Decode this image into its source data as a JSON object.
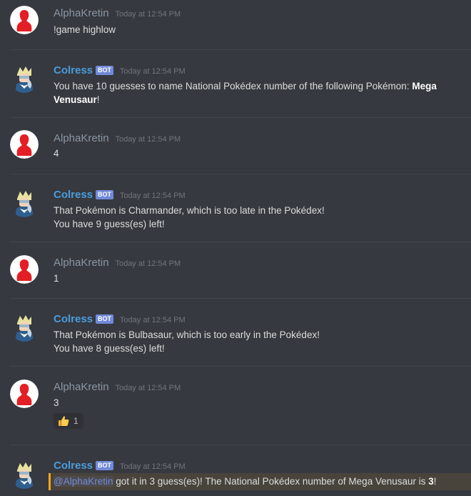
{
  "channel": {
    "messages": [
      {
        "author": "AlphaKretin",
        "is_bot": false,
        "timestamp": "Today at 12:54 PM",
        "text": "!game highlow"
      },
      {
        "author": "Colress",
        "is_bot": true,
        "bot_tag": "BOT",
        "timestamp": "Today at 12:54 PM",
        "text_prefix": "You have 10 guesses to name National Pokédex number of the following Pokémon: ",
        "text_bold": "Mega Venusaur",
        "text_suffix": "!"
      },
      {
        "author": "AlphaKretin",
        "is_bot": false,
        "timestamp": "Today at 12:54 PM",
        "text": "4"
      },
      {
        "author": "Colress",
        "is_bot": true,
        "bot_tag": "BOT",
        "timestamp": "Today at 12:54 PM",
        "line1": "That Pokémon is Charmander, which is too late in the Pokédex!",
        "line2": "You have 9 guess(es) left!"
      },
      {
        "author": "AlphaKretin",
        "is_bot": false,
        "timestamp": "Today at 12:54 PM",
        "text": "1"
      },
      {
        "author": "Colress",
        "is_bot": true,
        "bot_tag": "BOT",
        "timestamp": "Today at 12:54 PM",
        "line1": "That Pokémon is Bulbasaur, which is too early in the Pokédex!",
        "line2": "You have 8 guess(es) left!"
      },
      {
        "author": "AlphaKretin",
        "is_bot": false,
        "timestamp": "Today at 12:54 PM",
        "text": "3",
        "reaction": {
          "emoji": "thumbs-up",
          "count": "1"
        }
      },
      {
        "author": "Colress",
        "is_bot": true,
        "bot_tag": "BOT",
        "timestamp": "Today at 12:54 PM",
        "mention": "@AlphaKretin",
        "text_middle": " got it in 3 guess(es)! The National Pokédex number of Mega Venusaur is ",
        "text_bold": "3",
        "text_suffix": "!"
      }
    ]
  },
  "colors": {
    "background": "#36393f",
    "user_name": "#8a96a3",
    "bot_name": "#4a9cdc",
    "bot_tag": "#7289da",
    "mention_highlight": "#faa61a"
  }
}
